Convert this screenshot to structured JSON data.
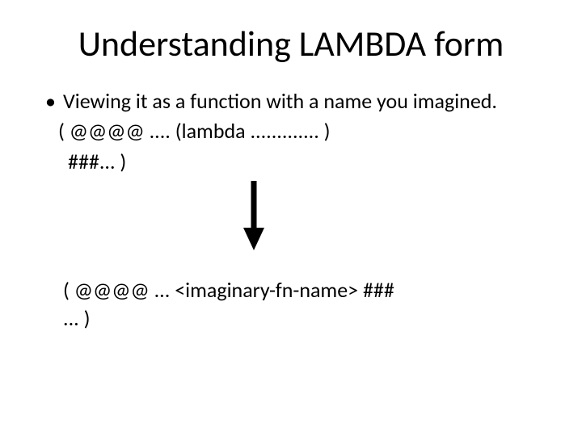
{
  "title": "Understanding LAMBDA form",
  "bullet": {
    "dot": "•",
    "text": "Viewing it as a function with a name you imagined."
  },
  "code_line_1": "( @@@@ ....  (lambda  ............. )",
  "code_line_2": "###... )",
  "result_line_1": "( @@@@  ...  <imaginary-fn-name>  ###",
  "result_line_2": "... )"
}
